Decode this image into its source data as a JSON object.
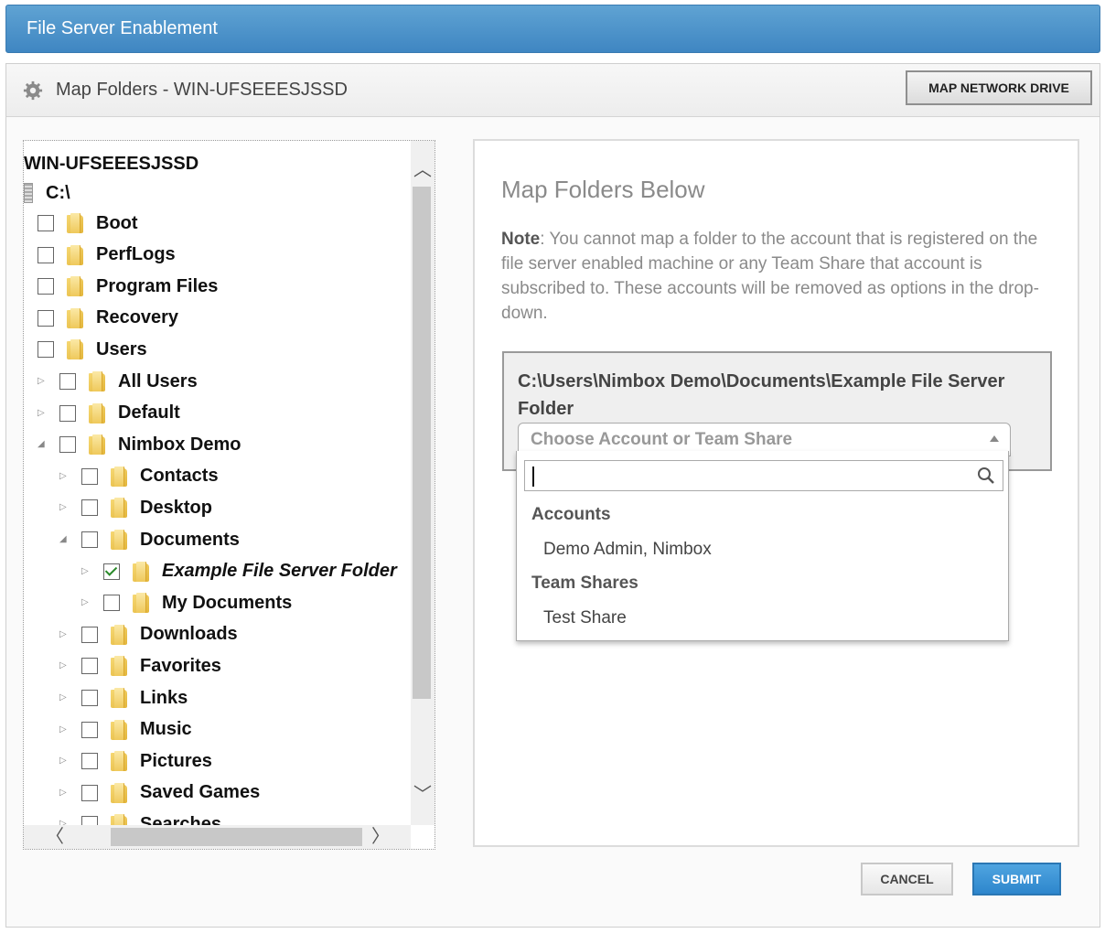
{
  "window": {
    "title": "File Server Enablement"
  },
  "header": {
    "title": "Map Folders - WIN-UFSEEESJSSD",
    "map_network_drive": "MAP NETWORK DRIVE",
    "icon": "gear-icon"
  },
  "tree": {
    "root": "WIN-UFSEEESJSSD",
    "drive": "C:\\",
    "nodes": [
      {
        "label": "Boot",
        "checked": false
      },
      {
        "label": "PerfLogs",
        "checked": false
      },
      {
        "label": "Program Files",
        "checked": false
      },
      {
        "label": "Recovery",
        "checked": false
      },
      {
        "label": "Users",
        "checked": false
      },
      {
        "label": "All Users",
        "checked": false
      },
      {
        "label": "Default",
        "checked": false
      },
      {
        "label": "Nimbox Demo",
        "checked": false
      },
      {
        "label": "Contacts",
        "checked": false
      },
      {
        "label": "Desktop",
        "checked": false
      },
      {
        "label": "Documents",
        "checked": false
      },
      {
        "label": "Example File Server Folder",
        "checked": true
      },
      {
        "label": "My Documents",
        "checked": false
      },
      {
        "label": "Downloads",
        "checked": false
      },
      {
        "label": "Favorites",
        "checked": false
      },
      {
        "label": "Links",
        "checked": false
      },
      {
        "label": "Music",
        "checked": false
      },
      {
        "label": "Pictures",
        "checked": false
      },
      {
        "label": "Saved Games",
        "checked": false
      },
      {
        "label": "Searches",
        "checked": false
      }
    ]
  },
  "right": {
    "heading": "Map Folders Below",
    "note_label": "Note",
    "note_text": ": You cannot map a folder to the account that is registered on the file server enabled machine or any Team Share that account is subscribed to. These accounts will be removed as options in the drop-down.",
    "mapping_path": "C:\\Users\\Nimbox Demo\\Documents\\Example File Server Folder",
    "select_placeholder": "Choose Account or Team Share"
  },
  "dropdown": {
    "search_value": "",
    "groups": [
      {
        "label": "Accounts",
        "options": [
          "Demo Admin, Nimbox"
        ]
      },
      {
        "label": "Team Shares",
        "options": [
          "Test Share"
        ]
      }
    ]
  },
  "footer": {
    "cancel": "CANCEL",
    "submit": "SUBMIT"
  },
  "colors": {
    "title_bar": "#4a90c8",
    "submit": "#3a8fd4",
    "check": "#2a8a2a"
  }
}
